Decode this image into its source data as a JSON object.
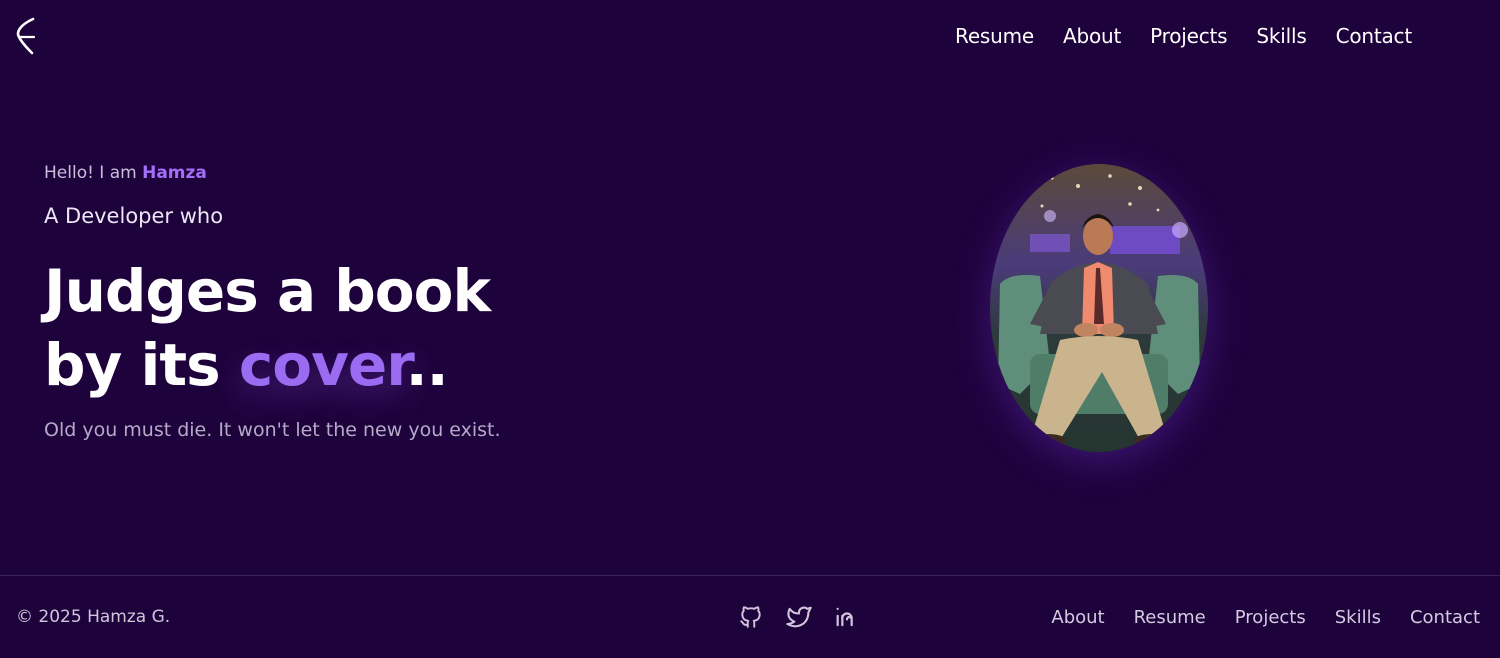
{
  "header": {
    "logo_icon": "chevron-moon-logo-icon",
    "nav": [
      {
        "label": "Resume"
      },
      {
        "label": "About"
      },
      {
        "label": "Projects"
      },
      {
        "label": "Skills"
      },
      {
        "label": "Contact"
      }
    ]
  },
  "hero": {
    "greeting_prefix": "Hello! I am ",
    "name": "Hamza",
    "tagline": "A Developer who",
    "headline_line1": "Judges a book",
    "headline_line2_prefix": "by its ",
    "headline_accent": "cover",
    "headline_suffix": "..",
    "quote": "Old you must die. It won't let the new you exist."
  },
  "footer": {
    "copyright": "© 2025 Hamza G.",
    "socials": [
      {
        "icon": "github-icon"
      },
      {
        "icon": "twitter-icon"
      },
      {
        "icon": "linkedin-icon"
      }
    ],
    "nav": [
      {
        "label": "About"
      },
      {
        "label": "Resume"
      },
      {
        "label": "Projects"
      },
      {
        "label": "Skills"
      },
      {
        "label": "Contact"
      }
    ]
  },
  "colors": {
    "background": "#1e023c",
    "accent": "#9b6cf2",
    "name_accent": "#a46ef8"
  }
}
